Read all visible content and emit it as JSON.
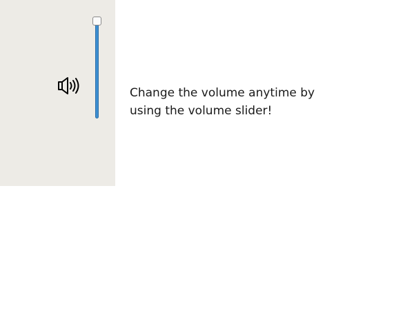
{
  "volume_panel": {
    "icon": "speaker-volume-icon",
    "slider": {
      "value": 1.0,
      "track_color": "#3d8ed1"
    }
  },
  "hint": {
    "line1": "Change the volume anytime by",
    "line2": "using the volume slider!"
  }
}
